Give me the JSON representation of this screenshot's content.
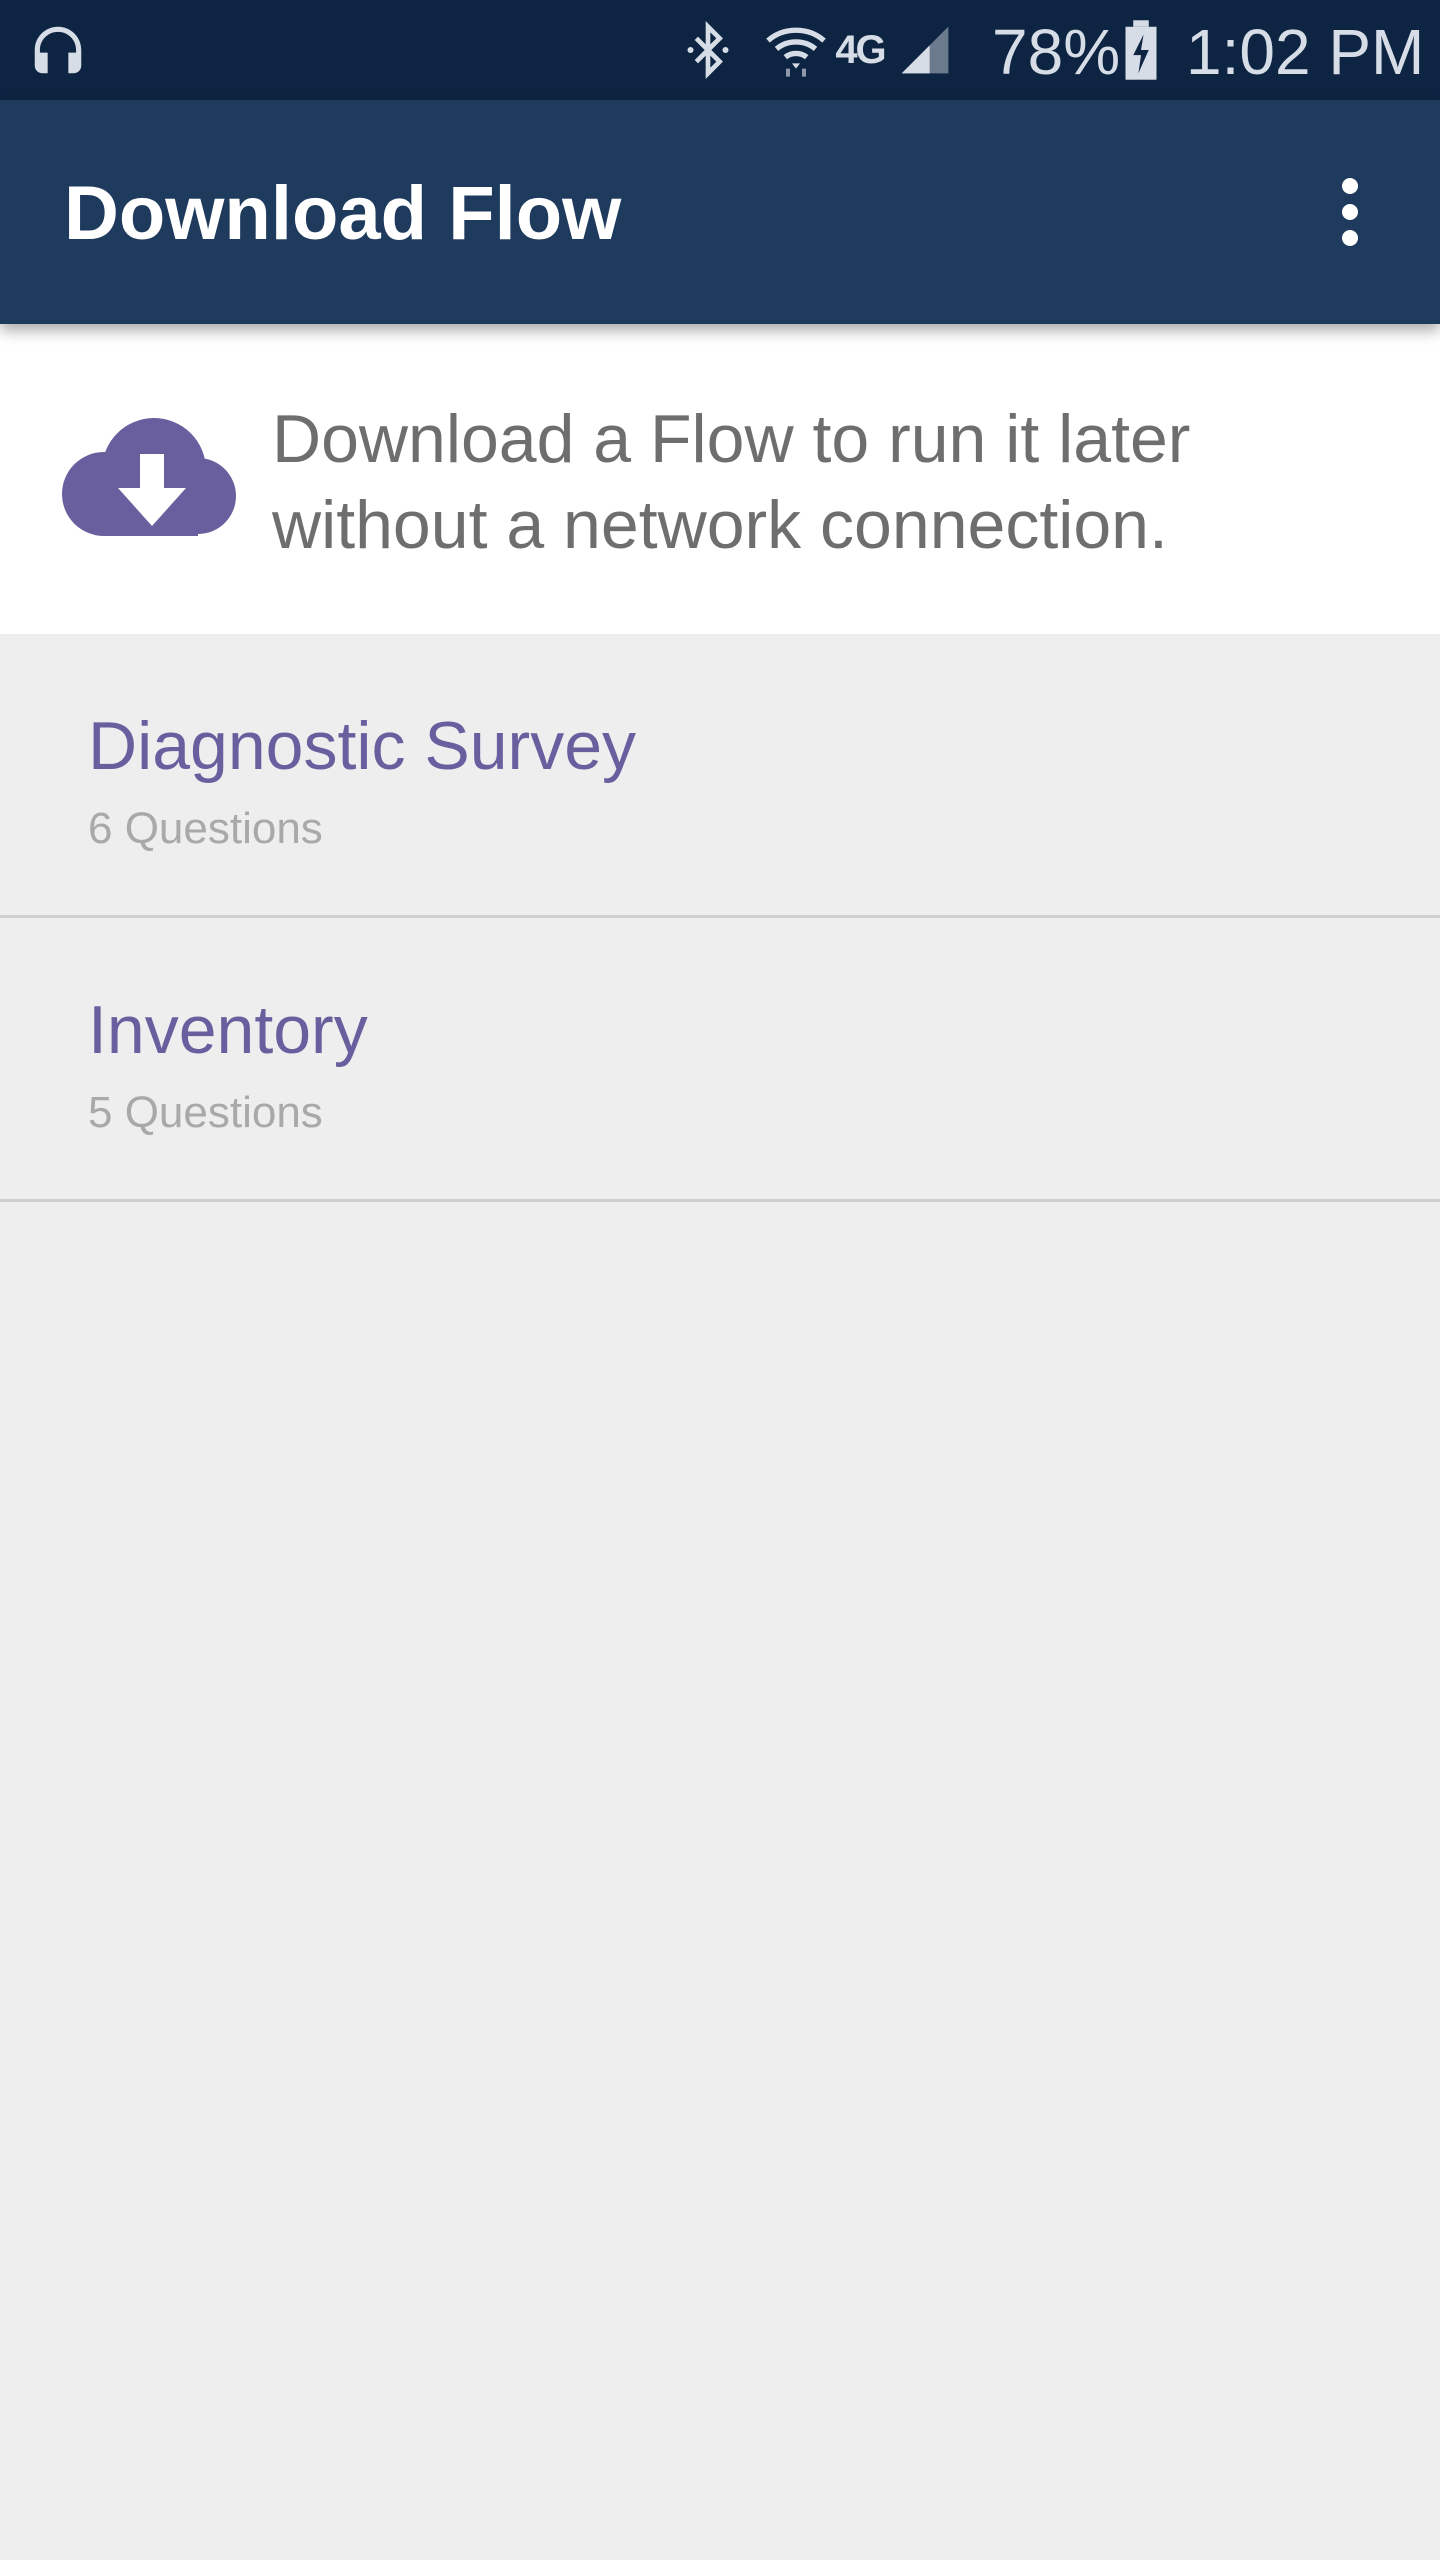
{
  "status_bar": {
    "icons": {
      "left": "headphones-icon",
      "bluetooth": "bluetooth-icon",
      "wifi": "wifi-icon",
      "network": "4g-lte-icon",
      "signal": "signal-icon",
      "battery": "battery-charging-icon"
    },
    "network_label": "4G",
    "battery_percent": "78%",
    "time": "1:02 PM"
  },
  "app_bar": {
    "title": "Download Flow",
    "overflow_icon": "more-vert-icon"
  },
  "banner": {
    "icon": "cloud-download-icon",
    "message": "Download a Flow to run it later without a network connection."
  },
  "flows": [
    {
      "name": "Diagnostic Survey",
      "count": "6 Questions"
    },
    {
      "name": "Inventory",
      "count": "5 Questions"
    }
  ],
  "colors": {
    "status_bar": "#0d2542",
    "app_bar": "#1e3a5c",
    "accent": "#6a5f9e",
    "background": "#eeeeee"
  }
}
